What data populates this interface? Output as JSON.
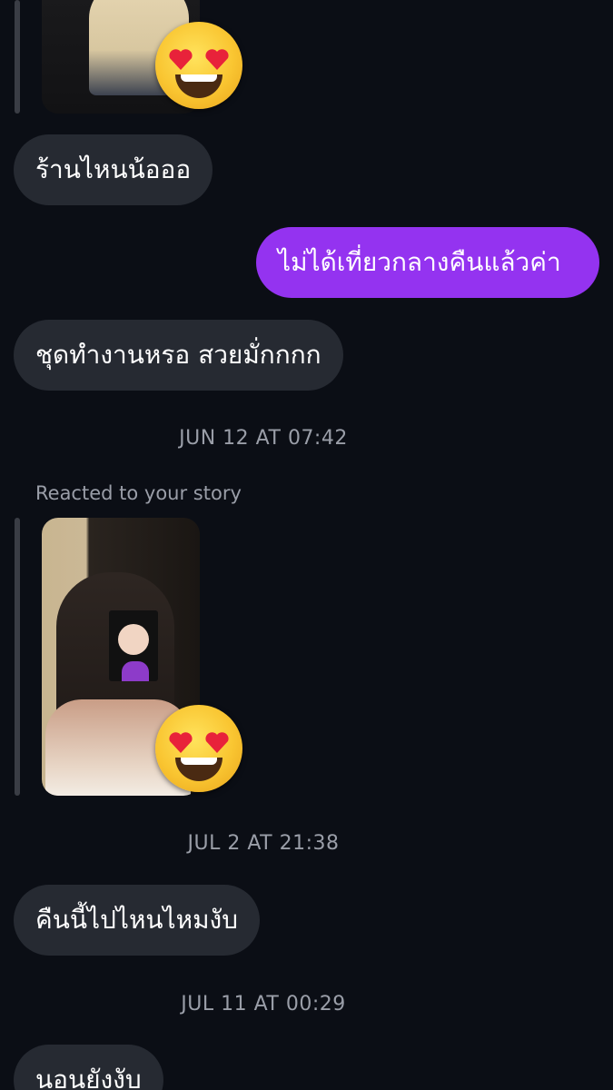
{
  "messages": {
    "m1": "ร้านไหนน้อออ",
    "m2": "ไม่ได้เที่ยวกลางคืนแล้วค่า",
    "m3": "ชุดทำงานหรอ สวยมั่กกกก",
    "m4": "คืนนี้ไปไหนไหมงับ",
    "m5": "นอนยังงับ"
  },
  "timestamps": {
    "t1": "JUN 12 AT 07:42",
    "t2": "JUL 2 AT 21:38",
    "t3": "JUL 11 AT 00:29"
  },
  "story": {
    "reacted_label": "Reacted to your story"
  },
  "reactions": {
    "emoji_icon": "heart-eyes-emoji-icon"
  },
  "colors": {
    "background": "#0b0e15",
    "incoming_bubble": "#262a32",
    "outgoing_bubble": "#9433f0",
    "meta_text": "#9a9ea8"
  }
}
